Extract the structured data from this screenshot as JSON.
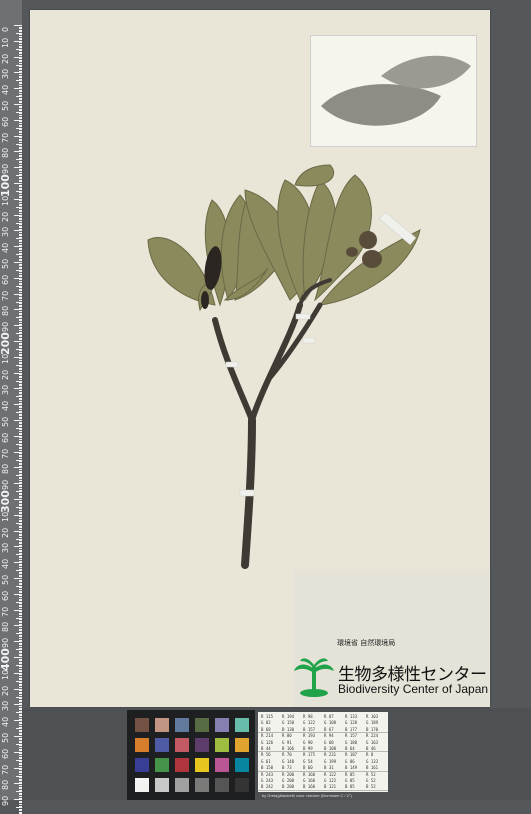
{
  "ruler": {
    "numbers_in_order": [
      "0",
      "10",
      "20",
      "30",
      "40",
      "50",
      "60",
      "70",
      "80",
      "90",
      "100",
      "10",
      "20",
      "30",
      "40",
      "50",
      "60",
      "70",
      "80",
      "90",
      "200",
      "10",
      "20",
      "30",
      "40",
      "50",
      "60",
      "70",
      "80",
      "90",
      "300",
      "10",
      "20",
      "30",
      "40",
      "50",
      "60",
      "70",
      "80",
      "90",
      "400",
      "10",
      "20",
      "30",
      "40",
      "50",
      "60",
      "70",
      "80",
      "90",
      "500"
    ]
  },
  "label": {
    "org_jp_small": "環境省 自然環境局",
    "org_name": "生物多様性センター",
    "org_en": "Biodiversity Center of Japan"
  },
  "color_table": {
    "rows": [
      [
        "R 115",
        "R 194",
        "R 98",
        "R 87",
        "R 133",
        "R 103"
      ],
      [
        "G 82",
        "G 150",
        "G 122",
        "G 108",
        "G 128",
        "G 189"
      ],
      [
        "B 68",
        "B 130",
        "B 157",
        "B 67",
        "B 177",
        "B 170"
      ],
      [
        "R 214",
        "R 80",
        "R 193",
        "R 94",
        "R 157",
        "R 224"
      ],
      [
        "G 126",
        "G 91",
        "G 90",
        "G 60",
        "G 188",
        "G 163"
      ],
      [
        "B 44",
        "B 166",
        "B 99",
        "B 108",
        "B 64",
        "B 46"
      ],
      [
        "R 56",
        "R 70",
        "R 175",
        "R 231",
        "R 187",
        "R 8"
      ],
      [
        "G 61",
        "G 148",
        "G 54",
        "G 199",
        "G 86",
        "G 133"
      ],
      [
        "B 150",
        "B 73",
        "B 60",
        "B 31",
        "B 149",
        "B 161"
      ],
      [
        "R 243",
        "R 200",
        "R 160",
        "R 122",
        "R 85",
        "R 52"
      ],
      [
        "G 243",
        "G 200",
        "G 160",
        "G 122",
        "G 85",
        "G 52"
      ],
      [
        "B 242",
        "B 200",
        "B 160",
        "B 121",
        "B 85",
        "B 52"
      ]
    ],
    "caption": "by GretagMacbeth color checker (Illuminant C / 2°)"
  },
  "colors": {
    "sheet": "#e9e6d8",
    "leaf": "#8b8a5c",
    "stem": "#3f3a33",
    "logo_green": "#21a34a"
  },
  "checker_colors": [
    "#735244",
    "#c29682",
    "#627a9d",
    "#576c43",
    "#8580b1",
    "#67bdaa",
    "#d67e2c",
    "#505ba6",
    "#c15a63",
    "#5e3c6c",
    "#9dbc40",
    "#e0a32e",
    "#383d96",
    "#469449",
    "#af363c",
    "#e7c71f",
    "#bb5695",
    "#0885a1",
    "#f3f3f2",
    "#c8c8c8",
    "#a0a0a0",
    "#7a7a79",
    "#555555",
    "#343434"
  ]
}
